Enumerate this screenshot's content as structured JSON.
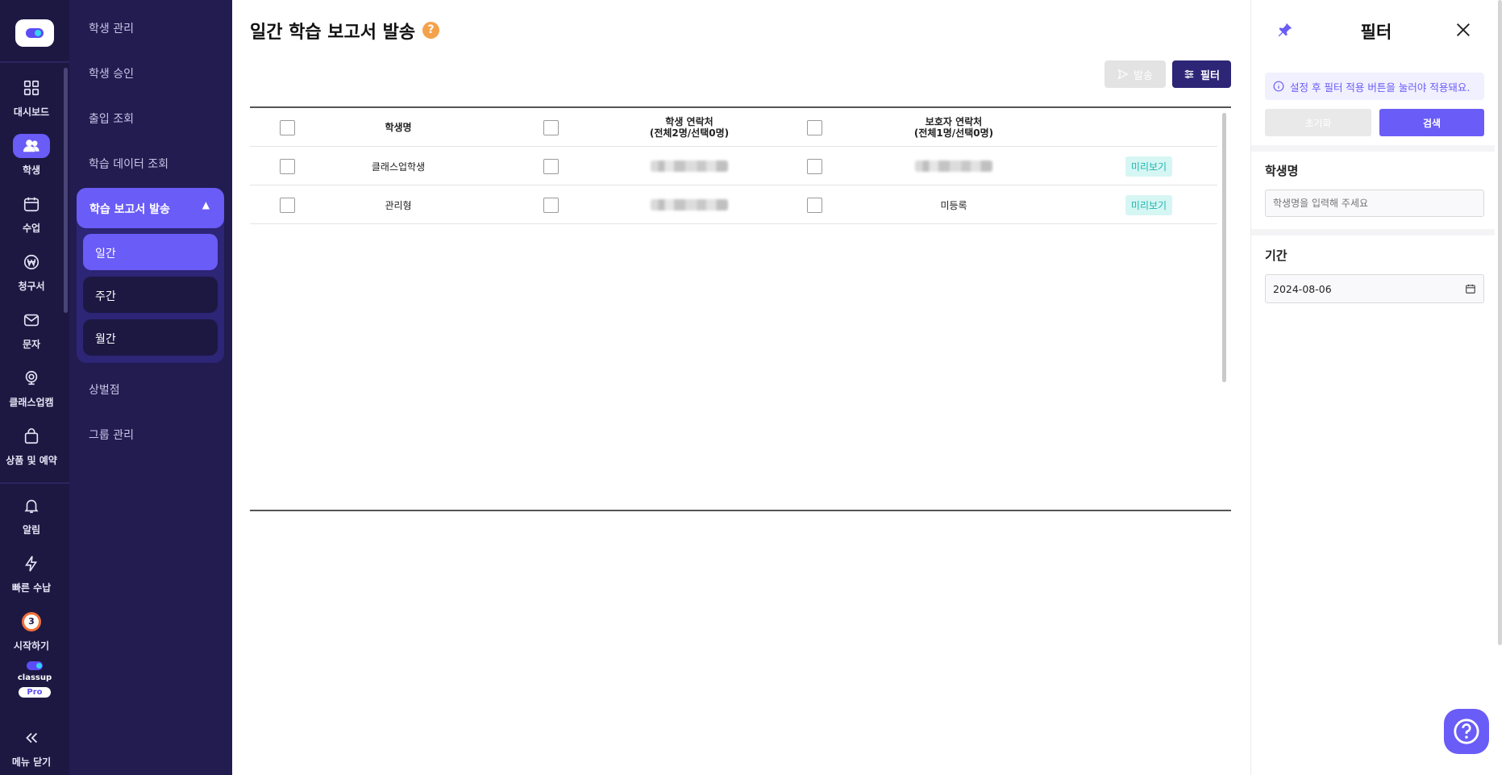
{
  "rail": {
    "items": [
      {
        "label": "대시보드",
        "icon": "grid-icon"
      },
      {
        "label": "학생",
        "icon": "users-icon",
        "active": true
      },
      {
        "label": "수업",
        "icon": "calendar-icon"
      },
      {
        "label": "청구서",
        "icon": "won-icon"
      },
      {
        "label": "문자",
        "icon": "mail-icon"
      },
      {
        "label": "클래스업캠",
        "icon": "webcam-icon"
      },
      {
        "label": "상품 및 예약",
        "icon": "bag-icon"
      }
    ],
    "bottom": [
      {
        "label": "알림",
        "icon": "bell-icon"
      },
      {
        "label": "빠른 수납",
        "icon": "bolt-icon"
      },
      {
        "label": "시작하기",
        "icon": "start-progress-icon",
        "count": "3"
      }
    ],
    "brand_name": "classup",
    "brand_badge": "Pro",
    "collapse_label": "메뉴 닫기"
  },
  "subnav": {
    "items": [
      "학생 관리",
      "학생 승인",
      "출입 조회",
      "학습 데이터 조회"
    ],
    "group_label": "학습 보고서 발송",
    "group_children": [
      "일간",
      "주간",
      "월간"
    ],
    "active_child": "일간",
    "items_after": [
      "상벌점",
      "그룹 관리"
    ]
  },
  "main": {
    "title": "일간 학습 보고서 발송",
    "send_label": "발송",
    "filter_label": "필터",
    "table": {
      "col_name": "학생명",
      "col_student_contact": "학생 연락처",
      "col_student_contact_sub": "(전체2명/선택0명)",
      "col_parent_contact": "보호자 연락처",
      "col_parent_contact_sub": "(전체1명/선택0명)",
      "rows": [
        {
          "name": "클래스업학생",
          "student_contact": "",
          "parent_contact": "",
          "action": "미리보기"
        },
        {
          "name": "관리형",
          "student_contact": "",
          "parent_contact": "미등록",
          "action": "미리보기"
        }
      ]
    }
  },
  "filter_panel": {
    "title": "필터",
    "notice": "설정 후 필터 적용 버튼을 눌러야 적용돼요.",
    "reset_label": "초기화",
    "search_label": "검색",
    "name_label": "학생명",
    "name_placeholder": "학생명을 입력해 주세요",
    "period_label": "기간",
    "period_value": "2024-08-06"
  },
  "colors": {
    "rail_bg": "#1d1842",
    "subnav_bg": "#221c51",
    "accent": "#6a5cf6",
    "dark_button": "#2d2576",
    "help": "#f4a24a",
    "badge_bg": "#d6f6f4",
    "badge_text": "#1fb5ad"
  }
}
